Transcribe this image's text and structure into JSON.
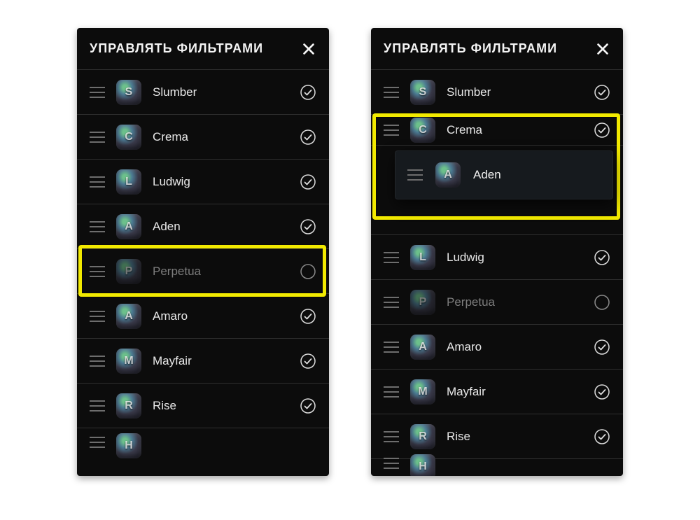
{
  "header_title": "УПРАВЛЯТЬ ФИЛЬТРАМИ",
  "left": {
    "rows": [
      {
        "letter": "S",
        "name": "Slumber",
        "checked": true,
        "dim": false
      },
      {
        "letter": "C",
        "name": "Crema",
        "checked": true,
        "dim": false
      },
      {
        "letter": "L",
        "name": "Ludwig",
        "checked": true,
        "dim": false
      },
      {
        "letter": "A",
        "name": "Aden",
        "checked": true,
        "dim": false
      },
      {
        "letter": "P",
        "name": "Perpetua",
        "checked": false,
        "dim": true
      },
      {
        "letter": "A",
        "name": "Amaro",
        "checked": true,
        "dim": false
      },
      {
        "letter": "M",
        "name": "Mayfair",
        "checked": true,
        "dim": false
      },
      {
        "letter": "R",
        "name": "Rise",
        "checked": true,
        "dim": false
      }
    ],
    "cut_letter": "H"
  },
  "right": {
    "rows": [
      {
        "letter": "S",
        "name": "Slumber",
        "checked": true,
        "dim": false
      },
      {
        "letter": "C",
        "name": "Crema",
        "checked": true,
        "dim": false
      },
      {
        "letter": "L",
        "name": "Ludwig",
        "checked": true,
        "dim": false
      },
      {
        "letter": "P",
        "name": "Perpetua",
        "checked": false,
        "dim": true
      },
      {
        "letter": "A",
        "name": "Amaro",
        "checked": true,
        "dim": false
      },
      {
        "letter": "M",
        "name": "Mayfair",
        "checked": true,
        "dim": false
      },
      {
        "letter": "R",
        "name": "Rise",
        "checked": true,
        "dim": false
      }
    ],
    "cut_letter": "H",
    "drag": {
      "letter": "A",
      "name": "Aden"
    }
  }
}
